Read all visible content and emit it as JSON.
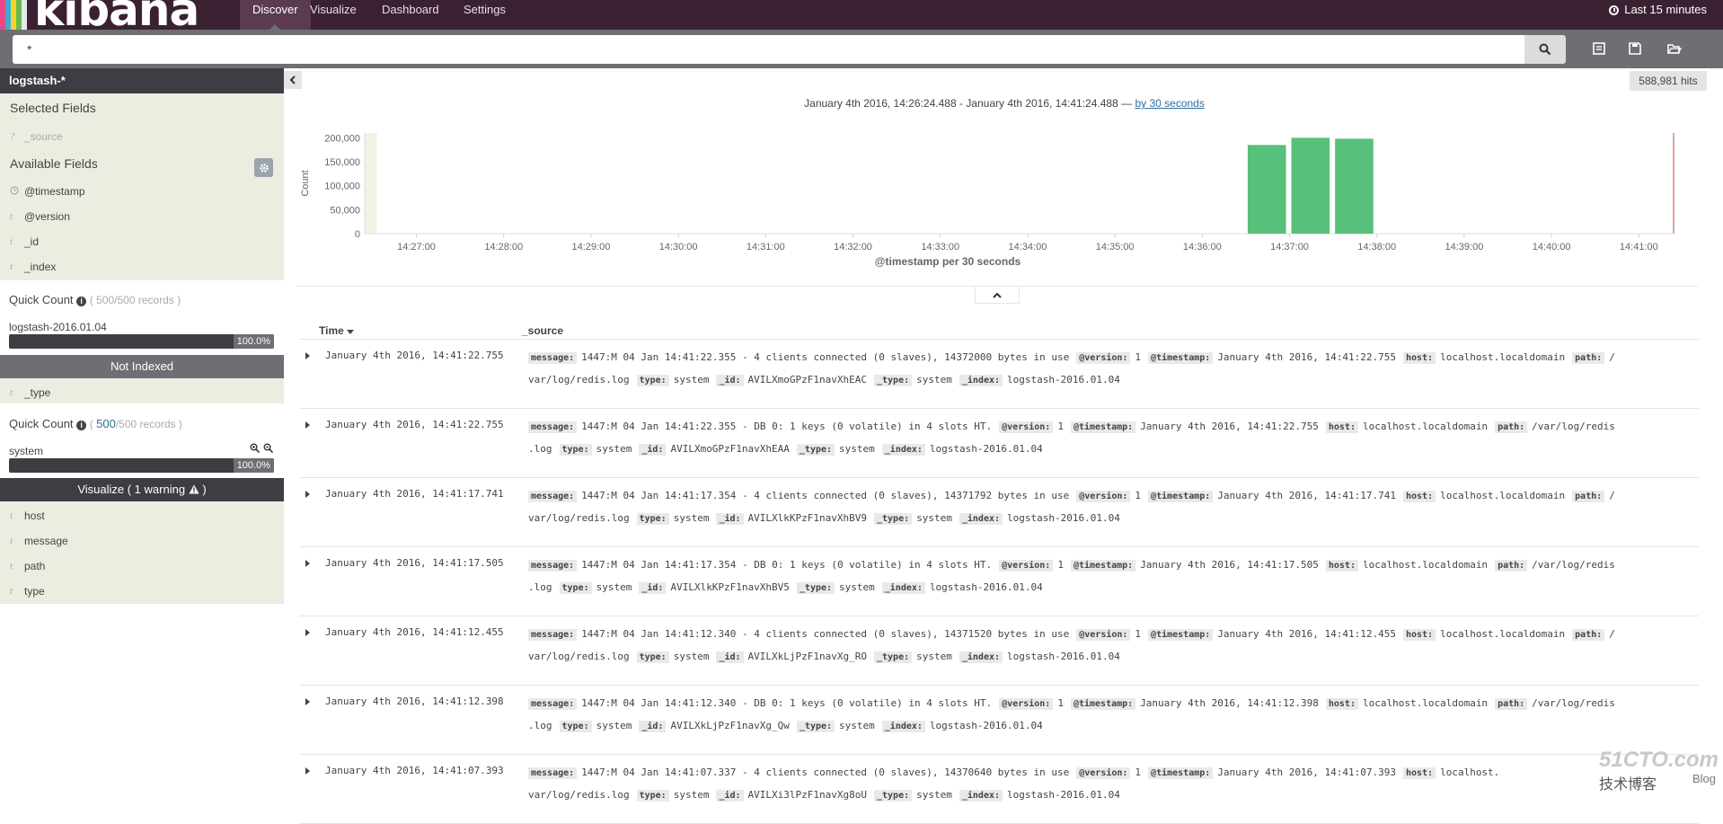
{
  "brand": {
    "name": "kibana",
    "stripe_colors": [
      "#e8488b",
      "#3caed2",
      "#f5d22e",
      "#67bb4e",
      "#e8e8e8"
    ]
  },
  "nav": {
    "tabs": [
      {
        "label": "Discover",
        "active": true
      },
      {
        "label": "Visualize",
        "active": false
      },
      {
        "label": "Dashboard",
        "active": false
      },
      {
        "label": "Settings",
        "active": false
      }
    ],
    "time_picker": "Last 15 minutes"
  },
  "search": {
    "query": "*",
    "icons": [
      "search-icon",
      "new-search-icon",
      "save-search-icon",
      "open-search-icon"
    ]
  },
  "sidebar": {
    "index_pattern": "logstash-*",
    "selected_fields_title": "Selected Fields",
    "selected_fields": [
      {
        "type": "?",
        "name": "_source"
      }
    ],
    "available_fields_title": "Available Fields",
    "available_fields": [
      {
        "type": "clock",
        "name": "@timestamp"
      },
      {
        "type": "t",
        "name": "@version"
      },
      {
        "type": "t",
        "name": "_id"
      },
      {
        "type": "t",
        "name": "_index"
      }
    ],
    "quick_count_1": {
      "title": "Quick Count",
      "records_total": "/500 records )",
      "records_prefix": "( 500",
      "item_name": "logstash-2016.01.04",
      "percent_label": "100.0%",
      "percent": 100,
      "footer": "Not Indexed"
    },
    "type_field": {
      "type": "t",
      "name": "_type"
    },
    "quick_count_2": {
      "title": "Quick Count",
      "records_prefix": "( ",
      "records_link": "500",
      "records_total": "/500 records )",
      "item_name": "system",
      "percent_label": "100.0%",
      "percent": 100,
      "footer": "Visualize ( 1 warning"
    },
    "more_fields": [
      {
        "type": "t",
        "name": "host"
      },
      {
        "type": "t",
        "name": "message"
      },
      {
        "type": "t",
        "name": "path"
      },
      {
        "type": "t",
        "name": "type"
      }
    ]
  },
  "main": {
    "hits_label": "588,981 hits",
    "time_range_text": "January 4th 2016, 14:26:24.488 - January 4th 2016, 14:41:24.488 —",
    "interval_link": "by 30 seconds",
    "columns": {
      "time": "Time",
      "source": "_source"
    }
  },
  "chart_data": {
    "type": "bar",
    "ylabel": "Count",
    "xlabel": "@timestamp per 30 seconds",
    "ylim": [
      0,
      210000
    ],
    "y_ticks": [
      "0",
      "50,000",
      "100,000",
      "150,000",
      "200,000"
    ],
    "y_tick_values": [
      0,
      50000,
      100000,
      150000,
      200000
    ],
    "x_ticks": [
      "14:27:00",
      "14:28:00",
      "14:29:00",
      "14:30:00",
      "14:31:00",
      "14:32:00",
      "14:33:00",
      "14:34:00",
      "14:35:00",
      "14:36:00",
      "14:37:00",
      "14:38:00",
      "14:39:00",
      "14:40:00",
      "14:41:00"
    ],
    "bars": [
      {
        "start": "14:36:30",
        "value": 185000
      },
      {
        "start": "14:37:00",
        "value": 200000
      },
      {
        "start": "14:37:30",
        "value": 198000
      }
    ],
    "x_start": "14:26:24.488",
    "x_end": "14:41:24.488",
    "bar_color": "#57c17b",
    "partial_bucket_color": "#f3f2e4",
    "now_marker_color": "#e0a49d"
  },
  "rows": [
    {
      "time": "January 4th 2016, 14:41:22.755",
      "line1": [
        [
          "message:",
          "1447:M 04 Jan 14:41:22.355 - 4 clients connected (0 slaves), 14372000 bytes in use"
        ],
        [
          "@version:",
          "1"
        ],
        [
          "@timestamp:",
          "January 4th 2016, 14:41:22.755"
        ],
        [
          "host:",
          "localhost.localdomain"
        ],
        [
          "path:",
          "/"
        ]
      ],
      "line2_prefix": "var/log/redis.log",
      "line2": [
        [
          "type:",
          "system"
        ],
        [
          "_id:",
          "AVILXmoGPzF1navXhEAC"
        ],
        [
          "_type:",
          "system"
        ],
        [
          "_index:",
          "logstash-2016.01.04"
        ]
      ]
    },
    {
      "time": "January 4th 2016, 14:41:22.755",
      "line1": [
        [
          "message:",
          "1447:M 04 Jan 14:41:22.355 - DB 0: 1 keys (0 volatile) in 4 slots HT."
        ],
        [
          "@version:",
          "1"
        ],
        [
          "@timestamp:",
          "January 4th 2016, 14:41:22.755"
        ],
        [
          "host:",
          "localhost.localdomain"
        ],
        [
          "path:",
          "/var/log/redis"
        ]
      ],
      "line2_prefix": ".log",
      "line2": [
        [
          "type:",
          "system"
        ],
        [
          "_id:",
          "AVILXmoGPzF1navXhEAA"
        ],
        [
          "_type:",
          "system"
        ],
        [
          "_index:",
          "logstash-2016.01.04"
        ]
      ]
    },
    {
      "time": "January 4th 2016, 14:41:17.741",
      "line1": [
        [
          "message:",
          "1447:M 04 Jan 14:41:17.354 - 4 clients connected (0 slaves), 14371792 bytes in use"
        ],
        [
          "@version:",
          "1"
        ],
        [
          "@timestamp:",
          "January 4th 2016, 14:41:17.741"
        ],
        [
          "host:",
          "localhost.localdomain"
        ],
        [
          "path:",
          "/"
        ]
      ],
      "line2_prefix": "var/log/redis.log",
      "line2": [
        [
          "type:",
          "system"
        ],
        [
          "_id:",
          "AVILXlkKPzF1navXhBV9"
        ],
        [
          "_type:",
          "system"
        ],
        [
          "_index:",
          "logstash-2016.01.04"
        ]
      ]
    },
    {
      "time": "January 4th 2016, 14:41:17.505",
      "line1": [
        [
          "message:",
          "1447:M 04 Jan 14:41:17.354 - DB 0: 1 keys (0 volatile) in 4 slots HT."
        ],
        [
          "@version:",
          "1"
        ],
        [
          "@timestamp:",
          "January 4th 2016, 14:41:17.505"
        ],
        [
          "host:",
          "localhost.localdomain"
        ],
        [
          "path:",
          "/var/log/redis"
        ]
      ],
      "line2_prefix": ".log",
      "line2": [
        [
          "type:",
          "system"
        ],
        [
          "_id:",
          "AVILXlkKPzF1navXhBV5"
        ],
        [
          "_type:",
          "system"
        ],
        [
          "_index:",
          "logstash-2016.01.04"
        ]
      ]
    },
    {
      "time": "January 4th 2016, 14:41:12.455",
      "line1": [
        [
          "message:",
          "1447:M 04 Jan 14:41:12.340 - 4 clients connected (0 slaves), 14371520 bytes in use"
        ],
        [
          "@version:",
          "1"
        ],
        [
          "@timestamp:",
          "January 4th 2016, 14:41:12.455"
        ],
        [
          "host:",
          "localhost.localdomain"
        ],
        [
          "path:",
          "/"
        ]
      ],
      "line2_prefix": "var/log/redis.log",
      "line2": [
        [
          "type:",
          "system"
        ],
        [
          "_id:",
          "AVILXkLjPzF1navXg_RO"
        ],
        [
          "_type:",
          "system"
        ],
        [
          "_index:",
          "logstash-2016.01.04"
        ]
      ]
    },
    {
      "time": "January 4th 2016, 14:41:12.398",
      "line1": [
        [
          "message:",
          "1447:M 04 Jan 14:41:12.340 - DB 0: 1 keys (0 volatile) in 4 slots HT."
        ],
        [
          "@version:",
          "1"
        ],
        [
          "@timestamp:",
          "January 4th 2016, 14:41:12.398"
        ],
        [
          "host:",
          "localhost.localdomain"
        ],
        [
          "path:",
          "/var/log/redis"
        ]
      ],
      "line2_prefix": ".log",
      "line2": [
        [
          "type:",
          "system"
        ],
        [
          "_id:",
          "AVILXkLjPzF1navXg_Qw"
        ],
        [
          "_type:",
          "system"
        ],
        [
          "_index:",
          "logstash-2016.01.04"
        ]
      ]
    },
    {
      "time": "January 4th 2016, 14:41:07.393",
      "line1": [
        [
          "message:",
          "1447:M 04 Jan 14:41:07.337 - 4 clients connected (0 slaves), 14370640 bytes in use"
        ],
        [
          "@version:",
          "1"
        ],
        [
          "@timestamp:",
          "January 4th 2016, 14:41:07.393"
        ],
        [
          "host:",
          "localhost."
        ]
      ],
      "line2_prefix": "var/log/redis.log",
      "line2": [
        [
          "type:",
          "system"
        ],
        [
          "_id:",
          "AVILXi3lPzF1navXg8oU"
        ],
        [
          "_type:",
          "system"
        ],
        [
          "_index:",
          "logstash-2016.01.04"
        ]
      ]
    }
  ],
  "watermark": {
    "line1": "51CTO.com",
    "line2": "技术博客",
    "line3": "Blog"
  }
}
